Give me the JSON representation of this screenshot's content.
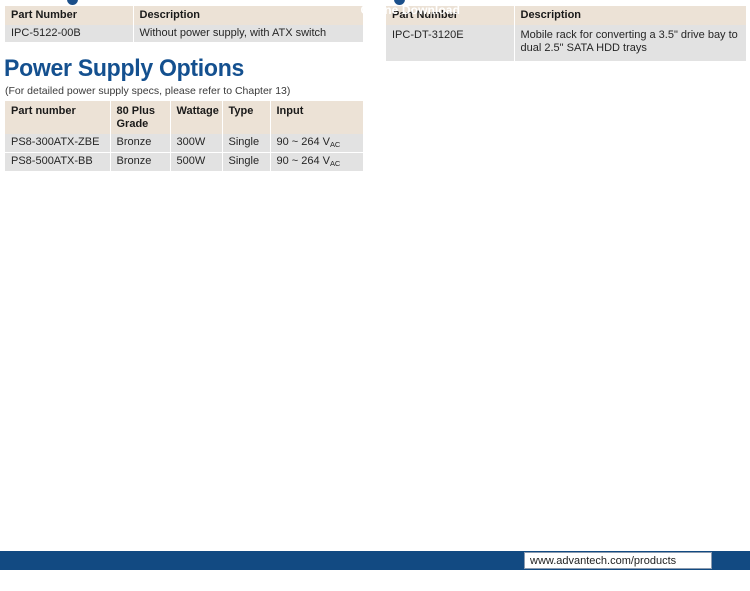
{
  "ornaments": {
    "left_bullet": "blue-circle-ornament",
    "right_bullet": "blue-circle-ornament"
  },
  "accessories_left": {
    "columns": [
      "Part Number",
      "Description"
    ],
    "rows": [
      {
        "part_number": "IPC-5122-00B",
        "description": "Without power supply, with ATX switch"
      }
    ]
  },
  "accessories_right": {
    "columns": [
      "Part Number",
      "Description"
    ],
    "rows": [
      {
        "part_number": "IPC-DT-3120E",
        "description": "Mobile rack for converting a 3.5\" drive bay to dual 2.5\" SATA HDD trays"
      }
    ]
  },
  "power_supply_section": {
    "heading": "Power Supply Options",
    "note": "(For detailed power supply specs, please refer to Chapter 13)",
    "columns": [
      "Part number",
      "80 Plus Grade",
      "Wattage",
      "Type",
      "Input"
    ],
    "column_header_line1": "80 Plus",
    "column_header_line2": "Grade",
    "rows": [
      {
        "part_number": "PS8-300ATX-ZBE",
        "grade": "Bronze",
        "wattage": "300W",
        "type": "Single",
        "input_value": "90 ~ 264 V",
        "input_unit": "AC"
      },
      {
        "part_number": "PS8-500ATX-BB",
        "grade": "Bronze",
        "wattage": "500W",
        "type": "Single",
        "input_value": "90 ~ 264 V",
        "input_unit": "AC"
      }
    ]
  },
  "footer": {
    "download_label": "Online Download",
    "url_value": "www.advantech.com/products"
  },
  "colors": {
    "heading_blue": "#14508f",
    "footer_blue": "#124a82",
    "table_header_beige": "#ece2d6",
    "table_row_gray": "#e2e2e2"
  }
}
